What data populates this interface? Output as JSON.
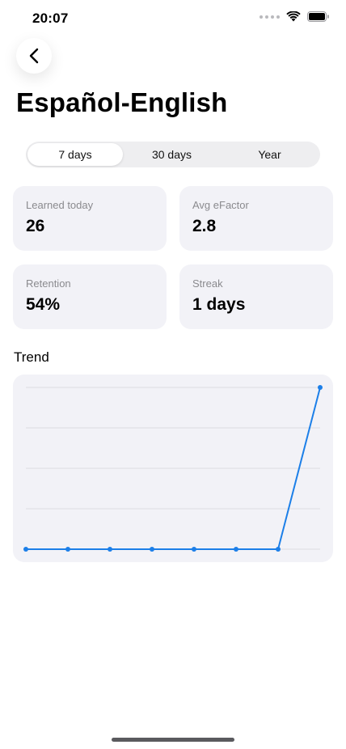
{
  "status_bar": {
    "time": "20:07"
  },
  "header": {
    "back_icon": "chevron-left-icon",
    "title": "Español-English"
  },
  "range_tabs": {
    "items": [
      {
        "label": "7 days",
        "selected": true
      },
      {
        "label": "30 days",
        "selected": false
      },
      {
        "label": "Year",
        "selected": false
      }
    ]
  },
  "stats": {
    "learned_today": {
      "label": "Learned today",
      "value": "26"
    },
    "avg_efactor": {
      "label": "Avg eFactor",
      "value": "2.8"
    },
    "retention": {
      "label": "Retention",
      "value": "54%"
    },
    "streak": {
      "label": "Streak",
      "value": "1 days"
    }
  },
  "trend": {
    "title": "Trend"
  },
  "colors": {
    "accent": "#1c7fe8",
    "card_bg": "#f2f2f7",
    "grid": "#dcdce0"
  },
  "chart_data": {
    "type": "line",
    "x": [
      1,
      2,
      3,
      4,
      5,
      6,
      7,
      8
    ],
    "series": [
      {
        "values": [
          0,
          0,
          0,
          0,
          0,
          0,
          0,
          26
        ]
      }
    ],
    "ylim": [
      0,
      26
    ],
    "grid": true,
    "legend": "none"
  }
}
